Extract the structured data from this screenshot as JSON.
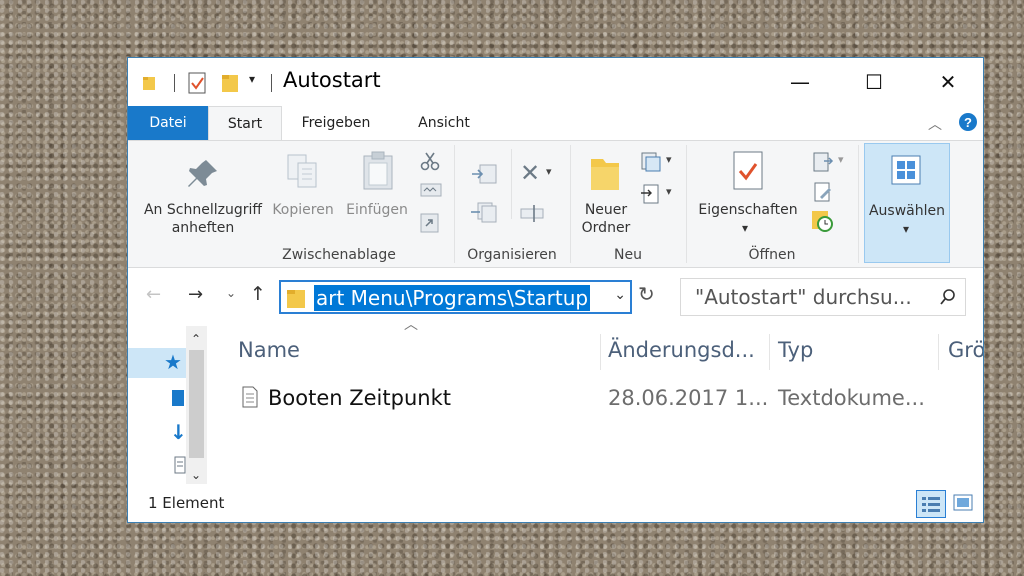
{
  "window": {
    "title": "Autostart",
    "controls": {
      "minimize": "—",
      "maximize": "☐",
      "close": "✕"
    }
  },
  "tabs": [
    {
      "label": "Datei"
    },
    {
      "label": "Start"
    },
    {
      "label": "Freigeben"
    },
    {
      "label": "Ansicht"
    }
  ],
  "ribbon": {
    "clipboard": {
      "pin_line1": "An Schnellzugriff",
      "pin_line2": "anheften",
      "copy": "Kopieren",
      "paste": "Einfügen",
      "group": "Zwischenablage"
    },
    "organize": {
      "group": "Organisieren"
    },
    "new": {
      "folder_line1": "Neuer",
      "folder_line2": "Ordner",
      "group": "Neu"
    },
    "open": {
      "properties": "Eigenschaften",
      "group": "Öffnen"
    },
    "select": {
      "label": "Auswählen"
    }
  },
  "address": {
    "path": "art Menu\\Programs\\Startup",
    "search_placeholder": "\"Autostart\" durchsu..."
  },
  "columns": [
    "Name",
    "Änderungsd...",
    "Typ",
    "Grö"
  ],
  "files": [
    {
      "name": "Booten Zeitpunkt",
      "modified": "28.06.2017 1...",
      "type": "Textdokume..."
    }
  ],
  "status": {
    "count": "1 Element"
  },
  "colors": {
    "accent": "#1979ca",
    "selection": "#0078d7",
    "header_text": "#4c607a"
  }
}
